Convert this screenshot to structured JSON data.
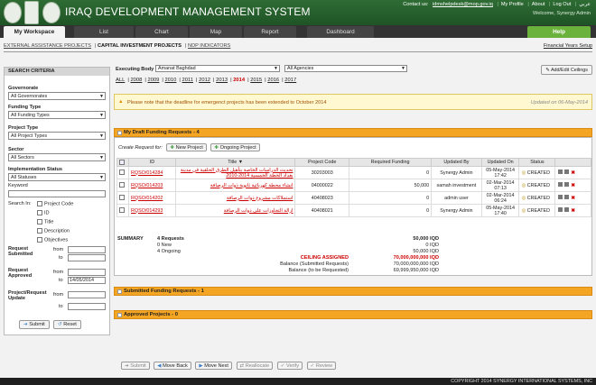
{
  "app": {
    "title": "IRAQ DEVELOPMENT MANAGEMENT SYSTEM",
    "contact": "Contact us:",
    "email": "idmshelpdesk@mop.gov.iq",
    "links": [
      "My Profile",
      "About",
      "Log Out",
      "عربي"
    ],
    "welcome": "Welcome, Synergy Admin"
  },
  "nav": {
    "tabs": [
      "My Workspace",
      "List",
      "Chart",
      "Map",
      "Report",
      "Dashboard"
    ],
    "help": "Help"
  },
  "subnav": {
    "items": [
      "EXTERNAL ASSISTANCE PROJECTS",
      "CAPITAL INVESTMENT PROJECTS",
      "NDP INDICATORS"
    ],
    "fy": "Financial Years Setup"
  },
  "sidebar": {
    "title": "SEARCH CRITERIA",
    "governorate_label": "Governorate",
    "governorate": "All Governorates",
    "funding_label": "Funding Type",
    "funding": "All Funding Types",
    "ptype_label": "Project Type",
    "ptype": "All Project Types",
    "sector_label": "Sector",
    "sector": "All Sectors",
    "status_label": "Implementation Status",
    "status": "All Statuses",
    "keyword_label": "Keyword",
    "searchin_label": "Search In:",
    "searchin": [
      "Project Code",
      "ID",
      "Title",
      "Description",
      "Objectives"
    ],
    "req_sub": "Request Submitted",
    "req_app": "Request Approved",
    "proj_upd": "Project/Request Update",
    "from": "from",
    "to": "to",
    "to_date": "14/05/2014",
    "submit": "Submit",
    "reset": "Reset"
  },
  "filters": {
    "label": "Executing Body",
    "exec": "Amanat Baghdad",
    "agency": "All Agencies",
    "years": [
      "ALL",
      "2008",
      "2009",
      "2010",
      "2011",
      "2012",
      "2013",
      "2014",
      "2015",
      "2016",
      "2017"
    ],
    "current_year": "2014",
    "ceilings": "Add/Edit Ceilings"
  },
  "notice": {
    "text": "Please note that the deadline for emergenct projects has been extended to October 2014",
    "date": "Updated on 06-May-2014"
  },
  "draft": {
    "title": "My Draft Funding Requests - 4",
    "create": "Create Request for:",
    "new": "New Project",
    "ongoing": "Ongoing Project",
    "cols": [
      "ID",
      "Title",
      "Project Code",
      "Required Funding",
      "Updated By",
      "Updated On",
      "Status"
    ],
    "rows": [
      {
        "id": "RQSO/014284",
        "title": "تحديث الدراسات الخاصة بتأهيل الطرق الحلقية في مدينة بغداد الخطة الخمسية 2014-2010",
        "code": "30203003",
        "funding": "0",
        "by": "Synergy Admin",
        "date": "05-May-2014",
        "time": "17:42",
        "status": "CREATED"
      },
      {
        "id": "RQSO/014203",
        "title": "انشاء محطة كهربائية ثانوية ذوات الرصافة",
        "code": "04000022",
        "funding": "50,000",
        "by": "samah investment",
        "date": "02-Mar-2014",
        "time": "07:13",
        "status": "CREATED"
      },
      {
        "id": "RQSO/014202",
        "title": "استملاكات مشروع ذوات الرصافة",
        "code": "40408023",
        "funding": "0",
        "by": "admin user",
        "date": "02-Mar-2014",
        "time": "06:24",
        "status": "CREATED"
      },
      {
        "id": "RQSO/014293",
        "title": "ازالة التجاوزات على ذوات الرصافة",
        "code": "40408021",
        "funding": "0",
        "by": "Synergy Admin",
        "date": "05-May-2014",
        "time": "17:40",
        "status": "CREATED"
      }
    ],
    "actions": [
      "Submit",
      "Move Back",
      "Move Next",
      "Reallocate",
      "Verify",
      "Review"
    ]
  },
  "summary": {
    "label": "SUMMARY",
    "lines": [
      "4 Requests",
      "0 New",
      "4 Ongoing"
    ],
    "vals": [
      "50,000 IQD",
      "0 IQD",
      "50,000 IQD"
    ],
    "ceiling_label": "CEILING ASSIGNED",
    "ceiling": "70,000,000,000 IQD",
    "bal_sub_label": "Balance (Submitted Requests)",
    "bal_sub": "70,000,000,000 IQD",
    "bal_req_label": "Balance (to be Requested)",
    "bal_req": "69,999,950,000 IQD"
  },
  "submitted": {
    "title": "Submitted Funding Requests - 1"
  },
  "approved": {
    "title": "Approved Projects - 0"
  },
  "footer": "COPYRIGHT 2014 SYNERGY INTERNATIONAL SYSTEMS, INC"
}
